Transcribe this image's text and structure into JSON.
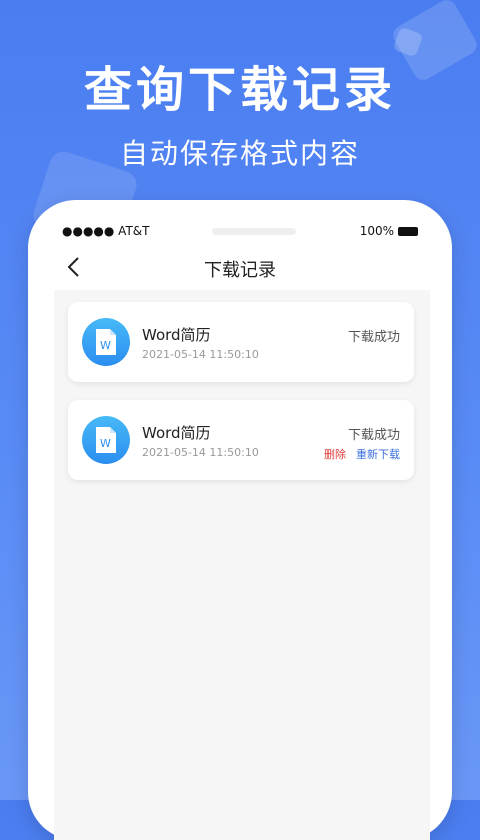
{
  "promo": {
    "headline": "查询下载记录",
    "subline": "自动保存格式内容"
  },
  "statusbar": {
    "carrier": "●●●●● AT&T",
    "battery": "100%"
  },
  "navbar": {
    "title": "下载记录",
    "back_icon": "chevron-left-icon"
  },
  "records": [
    {
      "name": "Word简历",
      "date": "2021-05-14 11:50:10",
      "status": "下载成功",
      "icon": "word-file-icon"
    },
    {
      "name": "Word简历",
      "date": "2021-05-14 11:50:10",
      "status": "下载成功",
      "delete_label": "删除",
      "redownload_label": "重新下载",
      "icon": "word-file-icon"
    }
  ],
  "colors": {
    "background": "#4a7df0",
    "delete": "#e23b3b",
    "redownload": "#3b6fe0"
  }
}
